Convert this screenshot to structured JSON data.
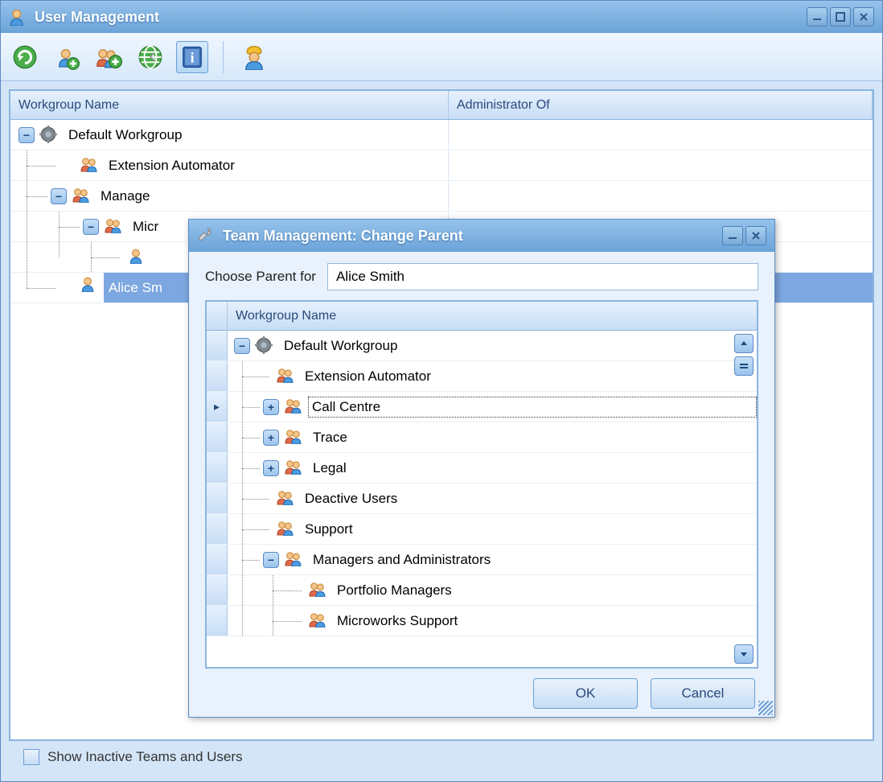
{
  "main": {
    "title": "User Management",
    "toolbar": {
      "refresh": "refresh",
      "add_user": "add-user",
      "add_group": "add-group",
      "globe": "globe",
      "info": "info",
      "contractor": "contractor"
    },
    "columns": {
      "name": "Workgroup Name",
      "admin": "Administrator Of"
    },
    "tree": {
      "root": "Default Workgroup",
      "extension": "Extension Automator",
      "managers": "Manage",
      "micro": "Micr",
      "alice": "Alice Sm"
    },
    "show_inactive": "Show Inactive Teams and Users"
  },
  "dialog": {
    "title": "Team Management: Change Parent",
    "choose_label": "Choose Parent for",
    "choose_value": "Alice Smith",
    "column_name": "Workgroup Name",
    "tree": {
      "root": "Default Workgroup",
      "ext": "Extension Automator",
      "call": "Call Centre",
      "trace": "Trace",
      "legal": "Legal",
      "deactive": "Deactive Users",
      "support": "Support",
      "managers": "Managers and Administrators",
      "portfolio": "Portfolio Managers",
      "microworks": "Microworks Support"
    },
    "ok": "OK",
    "cancel": "Cancel"
  }
}
